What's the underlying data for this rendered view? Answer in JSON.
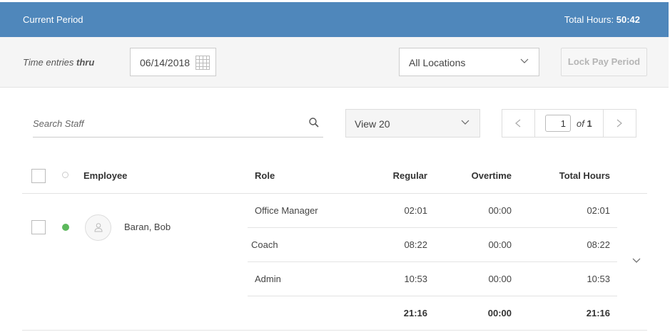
{
  "header": {
    "title": "Current Period",
    "total_label": "Total Hours:",
    "total_value": "50:42"
  },
  "filters": {
    "entries_label": "Time entries",
    "entries_label_bold": "thru",
    "date": "06/14/2018",
    "location": "All Locations",
    "lock_button": "Lock Pay Period"
  },
  "controls": {
    "search_placeholder": "Search Staff",
    "view": "View 20",
    "page": "1",
    "of_label": "of",
    "total_pages": "1"
  },
  "table": {
    "columns": {
      "employee": "Employee",
      "role": "Role",
      "regular": "Regular",
      "overtime": "Overtime",
      "total": "Total Hours"
    },
    "employee": {
      "name": "Baran, Bob",
      "status": "active",
      "status_color": "#5cb85c"
    },
    "rows": [
      {
        "role": "Office Manager",
        "regular": "02:01",
        "overtime": "00:00",
        "total": "02:01"
      },
      {
        "role": "Coach",
        "regular": "08:22",
        "overtime": "00:00",
        "total": "08:22"
      },
      {
        "role": "Admin",
        "regular": "10:53",
        "overtime": "00:00",
        "total": "10:53"
      }
    ],
    "subtotal": {
      "regular": "21:16",
      "overtime": "00:00",
      "total": "21:16"
    }
  },
  "colors": {
    "header_bg": "#4f87bb",
    "filter_bg": "#f5f5f5"
  },
  "icons": [
    "calendar-icon",
    "chevron-down-icon",
    "search-icon",
    "chevron-left-icon",
    "chevron-right-icon",
    "user-icon"
  ]
}
